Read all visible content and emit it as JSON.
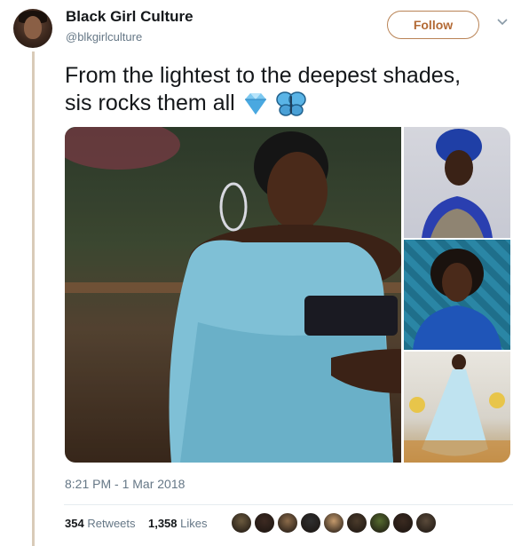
{
  "tweet": {
    "author_name": "Black Girl Culture",
    "author_handle": "@blkgirlculture",
    "follow_label": "Follow",
    "text_line1": "From the lightest to the deepest shades,",
    "text_line2": "sis rocks them all",
    "emojis": [
      "gem-icon",
      "butterfly-icon"
    ],
    "timestamp": "8:21 PM - 1 Mar 2018",
    "retweets_count": "354",
    "retweets_label": "Retweets",
    "likes_count": "1,358",
    "likes_label": "Likes"
  },
  "colors": {
    "accent": "#b36a35",
    "thread_line": "#d9cbb8",
    "muted_text": "#657786",
    "liker_avatars": [
      "#6b5a3e",
      "#3d2a22",
      "#8b6b4a",
      "#2f2f2f",
      "#c49a6c",
      "#4b3b2b",
      "#556b2f",
      "#3a2a20",
      "#5a4a3a"
    ]
  }
}
